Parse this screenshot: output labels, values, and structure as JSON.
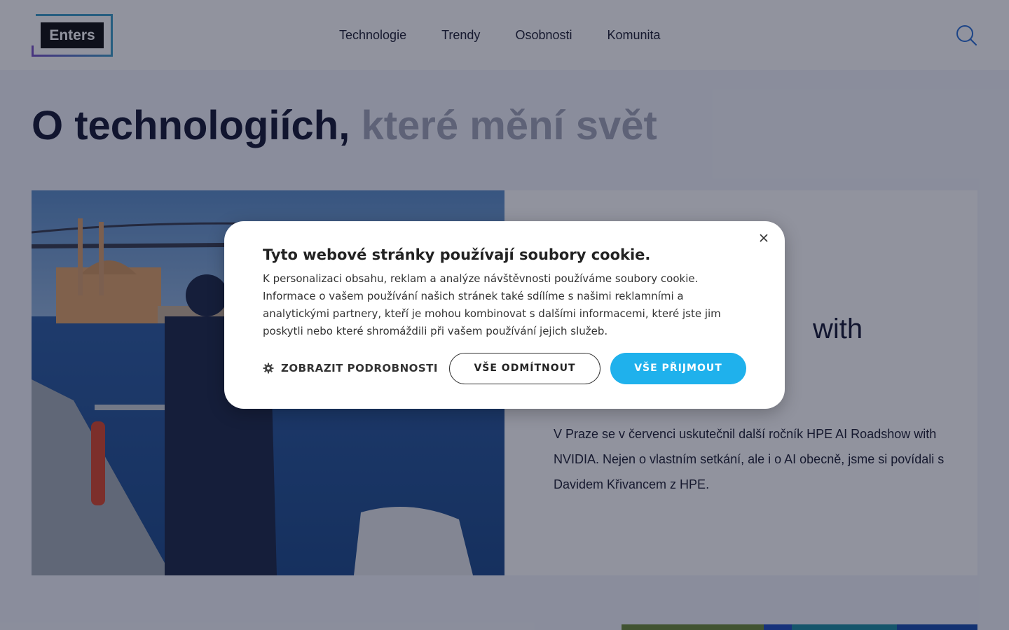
{
  "brand": {
    "logo_text": "Enters"
  },
  "nav": {
    "items": [
      "Technologie",
      "Trendy",
      "Osobnosti",
      "Komunita"
    ]
  },
  "hero": {
    "title_dark": "O technologiích,",
    "title_light": "které mění svět"
  },
  "article": {
    "heading_fragment": "with",
    "text": "V Praze se v červenci uskutečnil další ročník HPE AI Roadshow with NVIDIA. Nejen o vlastním setkání, ale i o AI obecně, jsme si povídali s Davidem Křivancem z HPE."
  },
  "cookie_dialog": {
    "title": "Tyto webové stránky používají soubory cookie.",
    "body": "K personalizaci obsahu, reklam a analýze návštěvnosti používáme soubory cookie. Informace o vašem používání našich stránek také sdílíme s našimi reklamními a analytickými partnery, kteří je mohou kombinovat s dalšími informacemi, které jste jim poskytli nebo které shromáždili při vašem používání jejich služeb.",
    "details_label": "ZOBRAZIT PODROBNOSTI",
    "reject_label": "VŠE ODMÍTNOUT",
    "accept_label": "VŠE PŘIJMOUT"
  },
  "colors": {
    "accent": "#1fb1ec",
    "search_icon": "#2a6fd6",
    "logo_frame_blue": "#3f9ec9",
    "logo_frame_purple": "#7a54c7"
  },
  "icons": {
    "search": "search-icon",
    "close": "close-icon",
    "details": "gear-icon"
  }
}
